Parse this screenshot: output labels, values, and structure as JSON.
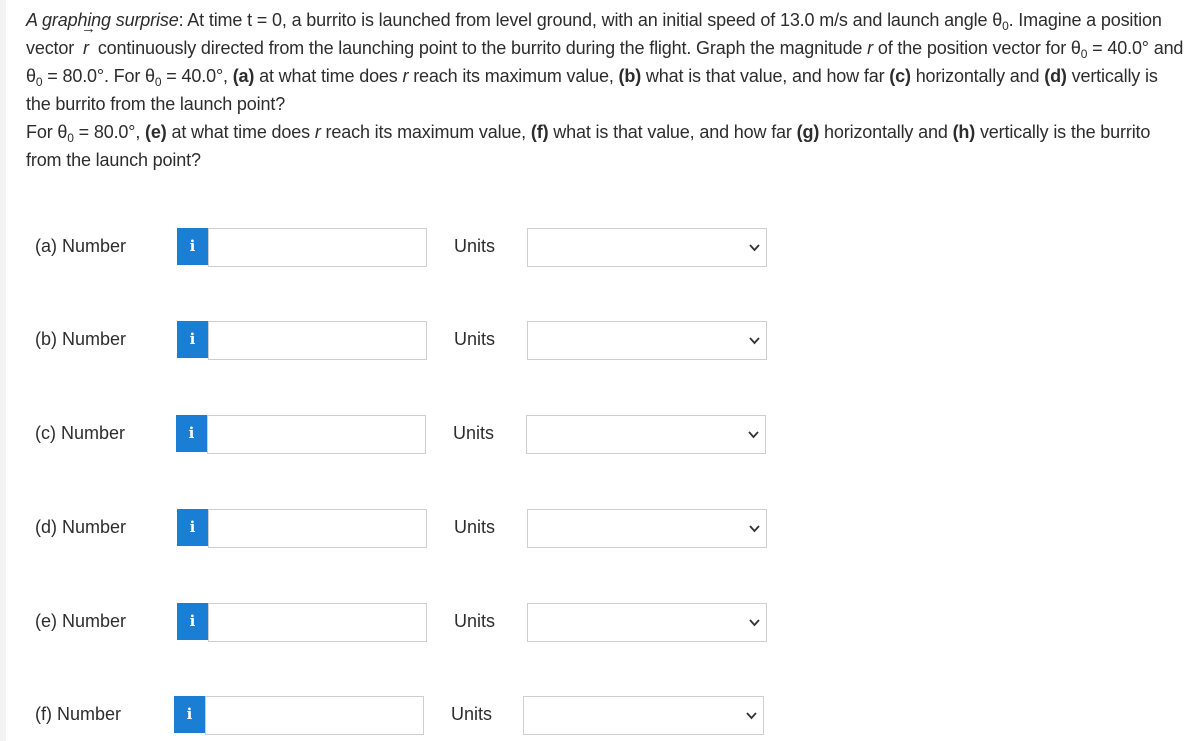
{
  "problem": {
    "intro_label": "A graphing surprise",
    "text_1": ": At time t = 0, a burrito is launched from level ground, with an initial speed of 13.0 m/s and launch angle θ",
    "text_2": ". Imagine a position vector ",
    "vector_symbol": "r",
    "text_3": " continuously directed from the launching point to the burrito during the flight. Graph the magnitude ",
    "r_italic": "r",
    "text_4": " of the position vector for θ",
    "text_5": " = 40.0° and θ",
    "text_6": " = 80.0°. For θ",
    "text_7": " = 40.0°, ",
    "a_mark": "(a)",
    "text_8": " at what time does ",
    "text_9": " reach its maximum value, ",
    "b_mark": "(b)",
    "text_10": " what is that value, and how far ",
    "c_mark": "(c)",
    "text_11": " horizontally and ",
    "d_mark": "(d)",
    "text_12": " vertically is the burrito from the launch point?",
    "p2_text_1": "For θ",
    "p2_text_2": " = 80.0°, ",
    "e_mark": "(e)",
    "p2_text_3": " at what time does ",
    "p2_text_4": " reach its maximum value, ",
    "f_mark": "(f)",
    "p2_text_5": " what is that value, and how far ",
    "g_mark": "(g)",
    "p2_text_6": " horizontally and ",
    "h_mark": "(h)",
    "p2_text_7": " vertically is the burrito from the launch point?",
    "subscript": "0"
  },
  "answers": [
    {
      "label": "(a)  Number",
      "info": "i",
      "value": "",
      "units_label": "Units",
      "units_value": ""
    },
    {
      "label": "(b)  Number",
      "info": "i",
      "value": "",
      "units_label": "Units",
      "units_value": ""
    },
    {
      "label": "(c)  Number",
      "info": "i",
      "value": "",
      "units_label": "Units",
      "units_value": ""
    },
    {
      "label": "(d)  Number",
      "info": "i",
      "value": "",
      "units_label": "Units",
      "units_value": ""
    },
    {
      "label": "(e)  Number",
      "info": "i",
      "value": "",
      "units_label": "Units",
      "units_value": ""
    },
    {
      "label": "(f)  Number",
      "info": "i",
      "value": "",
      "units_label": "Units",
      "units_value": ""
    }
  ],
  "icons": {
    "info": "info-icon",
    "dropdown": "chevron-down-icon"
  },
  "colors": {
    "info_button": "#1a7fd4",
    "border": "#cfcfcf",
    "text": "#2d2d2d"
  }
}
